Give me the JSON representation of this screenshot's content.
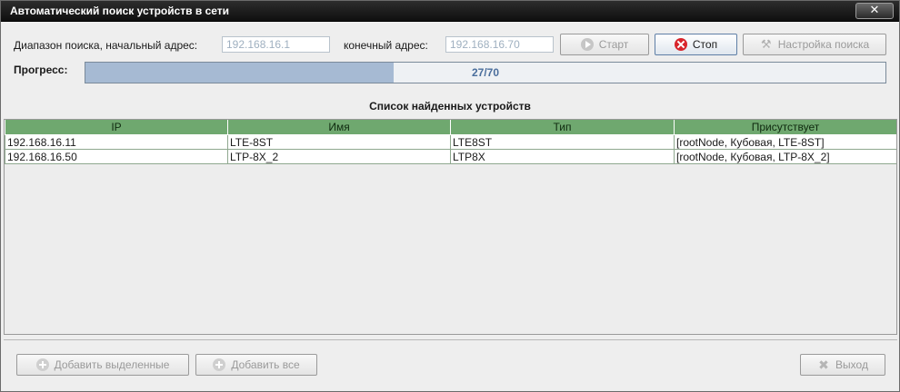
{
  "window": {
    "title": "Автоматический поиск устройств в сети",
    "close_symbol": "✕"
  },
  "search": {
    "start_label": "Диапазон поиска, начальный адрес:",
    "start_value": "192.168.16.1",
    "end_label": "конечный адрес:",
    "end_value": "192.168.16.70"
  },
  "buttons": {
    "start": "Старт",
    "stop": "Стоп",
    "settings": "Настройка поиска",
    "add_selected": "Добавить выделенные",
    "add_all": "Добавить все",
    "exit": "Выход"
  },
  "progress": {
    "label": "Прогресс:",
    "text": "27/70",
    "current": 27,
    "total": 70
  },
  "devices": {
    "title": "Список найденных устройств",
    "columns": [
      "IP",
      "Имя",
      "Тип",
      "Присутствует"
    ],
    "rows": [
      [
        "192.168.16.11",
        "LTE-8ST",
        "LTE8ST",
        "[rootNode, Кубовая, LTE-8ST]"
      ],
      [
        "192.168.16.50",
        "LTP-8X_2",
        "LTP8X",
        "[rootNode, Кубовая, LTP-8X_2]"
      ]
    ]
  },
  "colors": {
    "header_bg": "#6fa86f",
    "progress_fill": "#a6bad3",
    "stop_icon": "#d8252c"
  }
}
